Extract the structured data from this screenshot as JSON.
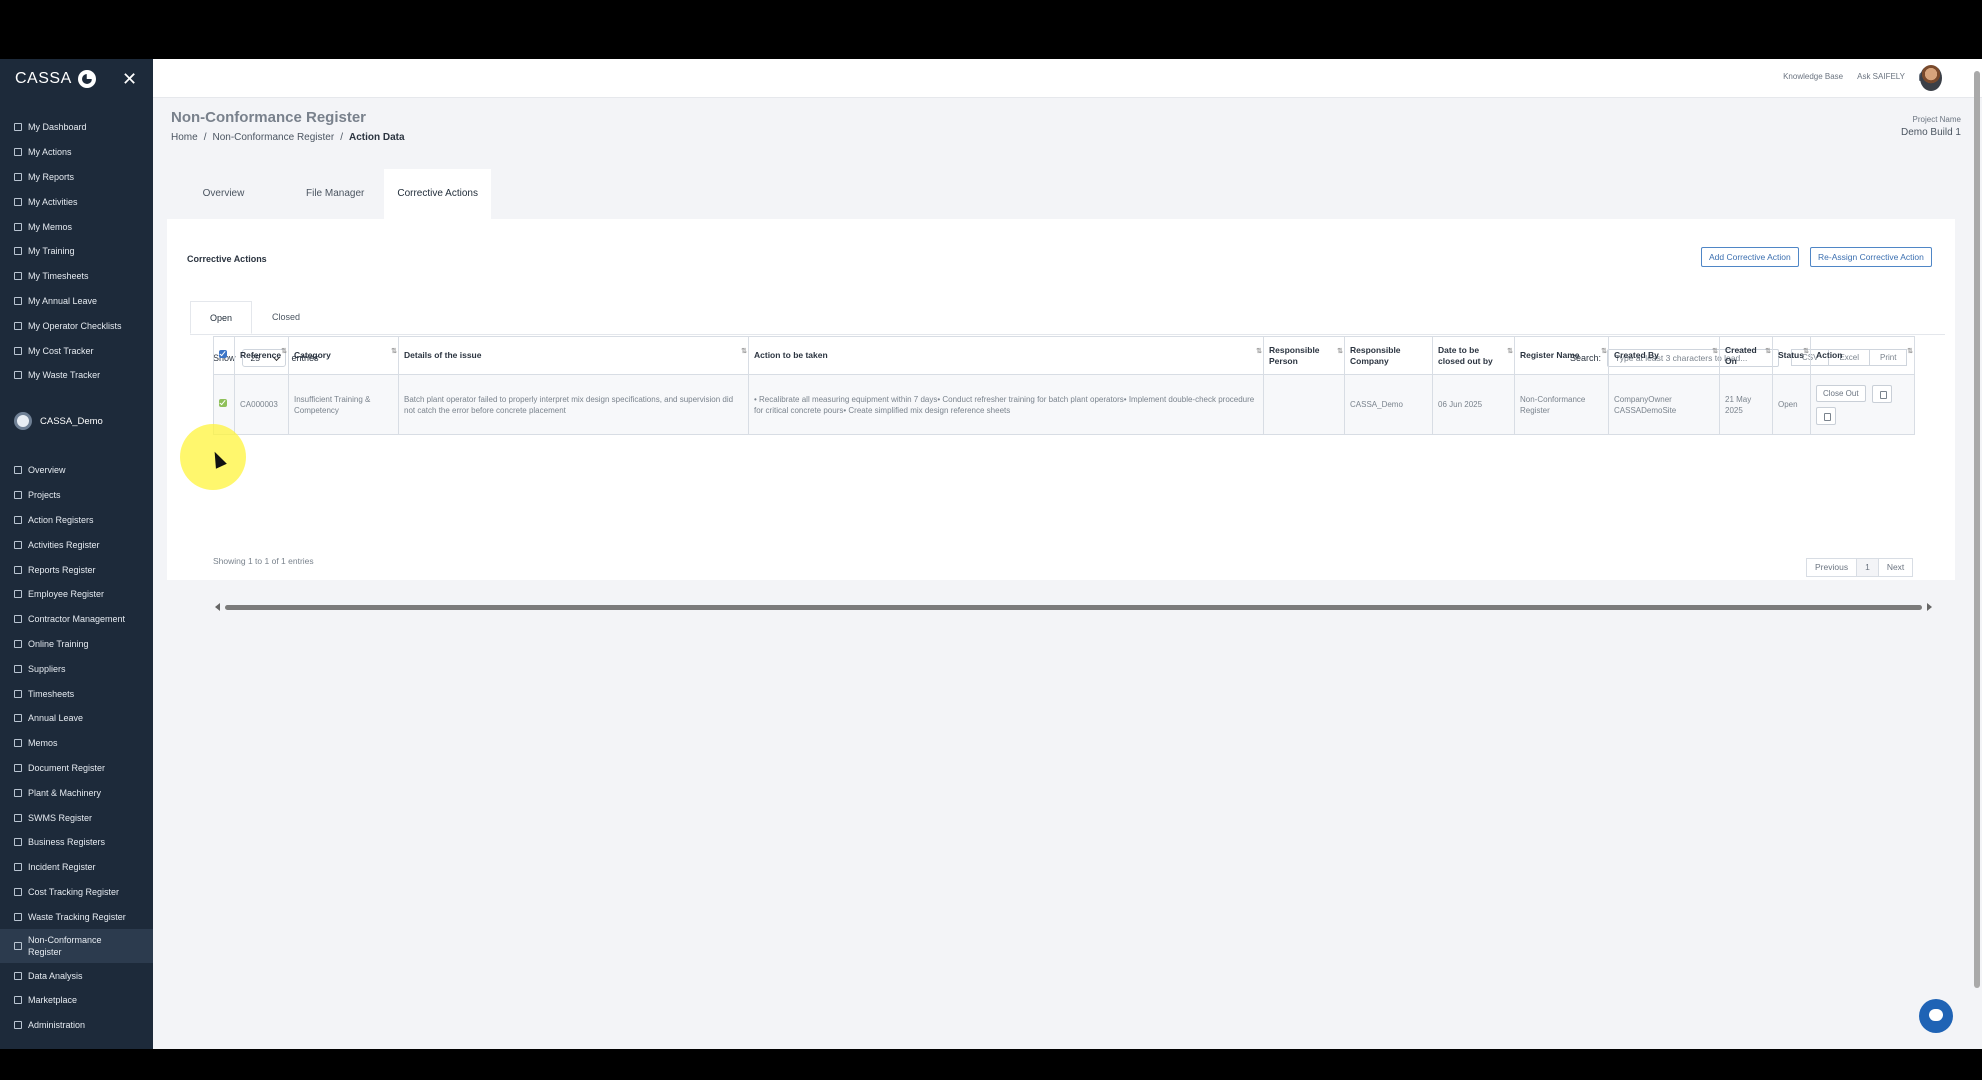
{
  "sidebar": {
    "brand": "CASSA",
    "personal": [
      {
        "label": "My Dashboard"
      },
      {
        "label": "My Actions"
      },
      {
        "label": "My Reports"
      },
      {
        "label": "My Activities"
      },
      {
        "label": "My Memos"
      },
      {
        "label": "My Training"
      },
      {
        "label": "My Timesheets"
      },
      {
        "label": "My Annual Leave"
      },
      {
        "label": "My Operator Checklists"
      },
      {
        "label": "My Cost Tracker"
      },
      {
        "label": "My Waste Tracker"
      }
    ],
    "org_name": "CASSA_Demo",
    "org_items": [
      {
        "label": "Overview"
      },
      {
        "label": "Projects"
      },
      {
        "label": "Action Registers"
      },
      {
        "label": "Activities Register"
      },
      {
        "label": "Reports Register"
      },
      {
        "label": "Employee Register"
      },
      {
        "label": "Contractor Management"
      },
      {
        "label": "Online Training"
      },
      {
        "label": "Suppliers"
      },
      {
        "label": "Timesheets"
      },
      {
        "label": "Annual Leave"
      },
      {
        "label": "Memos"
      },
      {
        "label": "Document Register"
      },
      {
        "label": "Plant & Machinery"
      },
      {
        "label": "SWMS Register"
      },
      {
        "label": "Business Registers"
      },
      {
        "label": "Incident Register"
      },
      {
        "label": "Cost Tracking Register"
      },
      {
        "label": "Waste Tracking Register"
      },
      {
        "label": "Non-Conformance Register"
      },
      {
        "label": "Data Analysis"
      },
      {
        "label": "Marketplace"
      },
      {
        "label": "Administration"
      }
    ]
  },
  "topbar": {
    "knowledge_base": "Knowledge Base",
    "ask": "Ask SAIFELY"
  },
  "page": {
    "title": "Non-Conformance Register",
    "crumbs": [
      "Home",
      "Non-Conformance Register",
      "Action Data"
    ],
    "project_label": "Project Name",
    "project_name": "Demo Build 1",
    "tabs": [
      "Overview",
      "File Manager",
      "Corrective Actions"
    ]
  },
  "card": {
    "title": "Corrective Actions",
    "add_btn": "Add Corrective Action",
    "reassign_btn": "Re-Assign Corrective Action",
    "subtabs": [
      "Open",
      "Closed"
    ],
    "show": "Show",
    "entries_value": "25",
    "entries": "entries",
    "search_label": "Search:",
    "search_placeholder": "Type at least 3 characters to load...",
    "export": [
      "CSV",
      "Excel",
      "Print"
    ],
    "columns": [
      "Reference",
      "Category",
      "Details of the issue",
      "Action to be taken",
      "Responsible Person",
      "Responsible Company",
      "Date to be closed out by",
      "Register Name",
      "Created By",
      "Created On",
      "Status",
      "Action"
    ],
    "rows": [
      {
        "reference": "CA000003",
        "category": "Insufficient Training & Competency",
        "details": "Batch plant operator failed to properly interpret mix design specifications, and supervision did not catch the error before concrete placement",
        "action": "• Recalibrate all measuring equipment within 7 days• Conduct refresher training for batch plant operators• Implement double-check procedure for critical concrete pours• Create simplified mix design reference sheets",
        "person": "",
        "company": "CASSA_Demo",
        "due": "06 Jun 2025",
        "register": "Non-Conformance Register",
        "created_by": "CompanyOwner CASSADemoSite",
        "created_on": "21 May 2025",
        "status": "Open",
        "close_btn": "Close Out"
      }
    ],
    "info": "Showing 1 to 1 of 1 entries",
    "pager": [
      "Previous",
      "1",
      "Next"
    ]
  }
}
